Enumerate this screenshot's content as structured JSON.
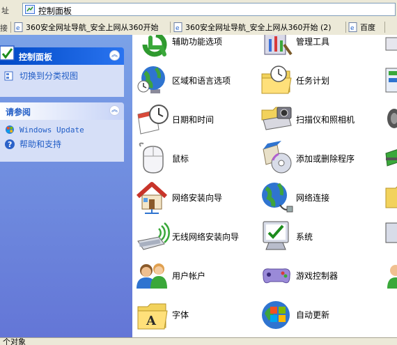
{
  "address": {
    "label": "址",
    "value": "控制面板"
  },
  "links": {
    "label": "接",
    "items": [
      {
        "label": "360安全网址导航_安全上网从360开始"
      },
      {
        "label": "360安全网址导航_安全上网从360开始 (2)"
      },
      {
        "label": "百度"
      }
    ]
  },
  "sidebar": {
    "control_panel": {
      "title": "控制面板",
      "tasks": [
        {
          "label": "切换到分类视图"
        }
      ]
    },
    "see_also": {
      "title": "请参阅",
      "tasks": [
        {
          "label": "Windows Update"
        },
        {
          "label": "帮助和支持"
        }
      ]
    }
  },
  "items": [
    {
      "label": "辅助功能选项",
      "icon": "accessibility-icon"
    },
    {
      "label": "管理工具",
      "icon": "admin-tools-icon"
    },
    {
      "label": "区域和语言选项",
      "icon": "globe-clock-icon"
    },
    {
      "label": "任务计划",
      "icon": "scheduled-tasks-icon"
    },
    {
      "label": "日期和时间",
      "icon": "calendar-clock-icon"
    },
    {
      "label": "扫描仪和照相机",
      "icon": "scanner-camera-icon"
    },
    {
      "label": "鼠标",
      "icon": "mouse-icon"
    },
    {
      "label": "添加或删除程序",
      "icon": "add-remove-programs-icon"
    },
    {
      "label": "网络安装向导",
      "icon": "house-network-icon"
    },
    {
      "label": "网络连接",
      "icon": "network-globe-icon"
    },
    {
      "label": "无线网络安装向导",
      "icon": "wireless-icon"
    },
    {
      "label": "系统",
      "icon": "system-monitor-icon"
    },
    {
      "label": "用户帐户",
      "icon": "users-icon"
    },
    {
      "label": "游戏控制器",
      "icon": "gamepad-icon"
    },
    {
      "label": "字体",
      "icon": "fonts-folder-icon"
    },
    {
      "label": "自动更新",
      "icon": "windows-update-icon"
    }
  ],
  "status": {
    "text": "个对象"
  },
  "colors": {
    "sidebar_bg": "#6d8be0",
    "panel_header": "#0049c6",
    "panel_body": "#d6dff7",
    "link_text": "#215dc6"
  }
}
